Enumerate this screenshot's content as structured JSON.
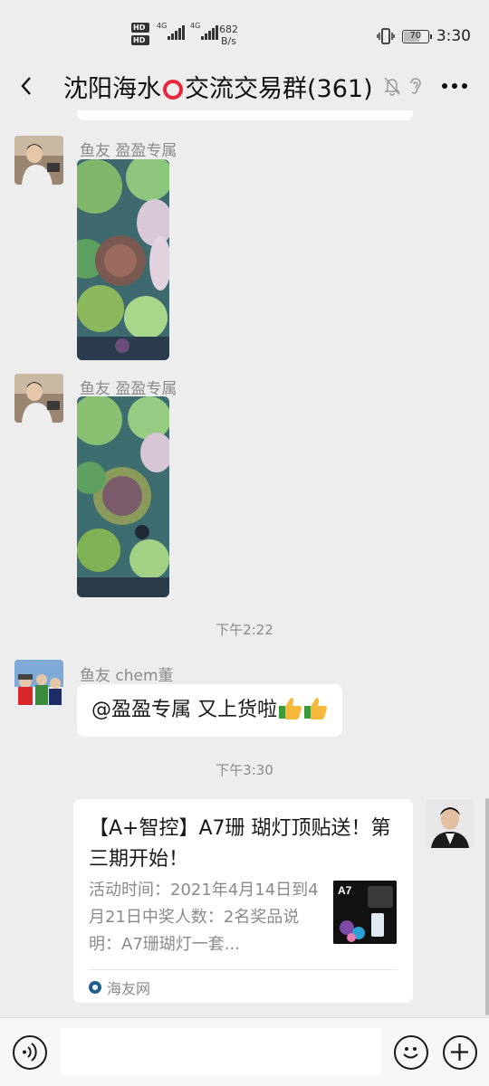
{
  "status_bar": {
    "hd_labels": [
      "HD",
      "HD"
    ],
    "network_labels": [
      "4G",
      "4G"
    ],
    "net_speed_value": "682",
    "net_speed_unit": "B/s",
    "battery_percent": 70,
    "battery_label": "70",
    "time": "3:30"
  },
  "header": {
    "title_before": "沈阳海水",
    "title_after": "交流交易群(361)",
    "icons": [
      "back-arrow-icon",
      "mute-bell-icon",
      "earpiece-icon",
      "more-icon"
    ]
  },
  "messages": [
    {
      "sender": "鱼友 盈盈专属",
      "type": "image"
    },
    {
      "sender": "鱼友 盈盈专属",
      "type": "image"
    }
  ],
  "timestamps": [
    "下午2:22",
    "下午3:30"
  ],
  "text_message": {
    "sender": "鱼友 chem董",
    "text": "@盈盈专属  又上货啦"
  },
  "link_card": {
    "title": "【A+智控】A7珊 瑚灯顶贴送！第三期开始！",
    "description": "活动时间：2021年4月14日到4月21日中奖人数：2名奖品说明：A7珊瑚灯一套...",
    "source": "海友网",
    "thumb_label": "A7"
  },
  "input_bar": {
    "message_value": "",
    "icons": [
      "voice-icon",
      "emoji-icon",
      "add-icon"
    ]
  },
  "colors": {
    "background": "#ededed",
    "bubble": "#ffffff",
    "accent_ring": "#e8263b",
    "meta_text": "#8a8a8a"
  }
}
